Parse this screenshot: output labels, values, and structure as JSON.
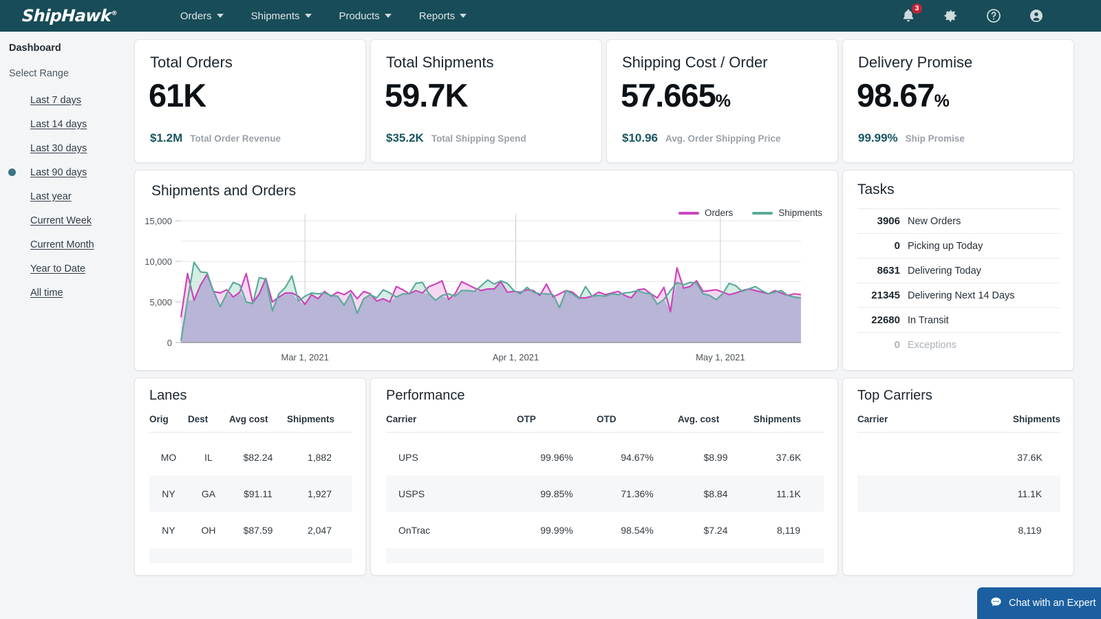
{
  "nav": {
    "logo": "ShipHawk",
    "logo_tm": "®",
    "items": [
      {
        "label": "Orders",
        "icon": "chevron-down-icon"
      },
      {
        "label": "Shipments",
        "icon": "chevron-down-icon"
      },
      {
        "label": "Products",
        "icon": "chevron-down-icon"
      },
      {
        "label": "Reports",
        "icon": "chevron-down-icon"
      }
    ],
    "notifications_badge": "3",
    "icons": [
      "bell-icon",
      "gear-icon",
      "help-icon",
      "account-icon"
    ],
    "background_color": "#174c58"
  },
  "sidebar": {
    "title": "Dashboard",
    "subtitle": "Select Range",
    "selected": "Last 90 days",
    "selected_color": "#3a7487",
    "items": [
      {
        "label": "Last 7 days",
        "selected": false
      },
      {
        "label": "Last 14 days",
        "selected": false
      },
      {
        "label": "Last 30 days",
        "selected": false
      },
      {
        "label": "Last 90 days",
        "selected": true
      },
      {
        "label": "Last year",
        "selected": false
      },
      {
        "label": "Current Week",
        "selected": false
      },
      {
        "label": "Current Month",
        "selected": false
      },
      {
        "label": "Year to Date",
        "selected": false
      },
      {
        "label": "All time",
        "selected": false
      }
    ]
  },
  "kpis": [
    {
      "title": "Total Orders",
      "value": "61K",
      "unit": "",
      "foot_value": "$1.2M",
      "foot_label": "Total Order Revenue"
    },
    {
      "title": "Total Shipments",
      "value": "59.7K",
      "unit": "",
      "foot_value": "$35.2K",
      "foot_label": "Total Shipping Spend"
    },
    {
      "title": "Shipping Cost / Order",
      "value": "57.665",
      "unit": "%",
      "foot_value": "$10.96",
      "foot_label": "Avg. Order Shipping Price"
    },
    {
      "title": "Delivery Promise",
      "value": "98.67",
      "unit": "%",
      "foot_value": "99.99%",
      "foot_label": "Ship Promise"
    }
  ],
  "chart_panel": {
    "title": "Shipments and Orders"
  },
  "chart_data": {
    "type": "area",
    "title": "Shipments and Orders",
    "xlabel": "",
    "ylabel": "",
    "ylim": [
      0,
      15000
    ],
    "yticks": [
      0,
      5000,
      10000,
      15000
    ],
    "ytick_labels": [
      "0",
      "5,000",
      "10,000",
      "15,000"
    ],
    "xtick_labels": [
      "Mar 1, 2021",
      "Apr 1, 2021",
      "May 1, 2021"
    ],
    "xtick_positions": [
      0.2,
      0.54,
      0.87
    ],
    "grid": true,
    "legend": "top-right",
    "colors": {
      "Orders": "#cc44bb",
      "Shipments": "#5aab9b",
      "orders_fill": "#f2c8ec",
      "shipments_fill": "#bfe3d8",
      "overlap_fill": "#b6b3d6"
    },
    "series": [
      {
        "name": "Orders",
        "color": "#cc44bb",
        "values": [
          3100,
          8500,
          5200,
          7100,
          8400,
          6300,
          6100,
          6500,
          5600,
          6200,
          8500,
          4900,
          6000,
          7900,
          5000,
          5600,
          6100,
          6100,
          5700,
          4700,
          5900,
          5400,
          6300,
          5700,
          6200,
          5900,
          6400,
          5400,
          6300,
          6000,
          5100,
          5400,
          5000,
          6900,
          6500,
          6000,
          6400,
          6100,
          6900,
          7200,
          7600,
          5300,
          6000,
          7500,
          7100,
          6700,
          6400,
          6600,
          6600,
          7500,
          6200,
          6300,
          6200,
          6500,
          6400,
          5800,
          7200,
          5600,
          6000,
          6400,
          6200,
          5500,
          5500,
          5700,
          6200,
          5900,
          6100,
          6300,
          5800,
          5500,
          6500,
          6600,
          6000,
          5500,
          6800,
          3800,
          9200,
          6700,
          6900,
          7600,
          6300,
          6400,
          6500,
          6200,
          5900,
          6100,
          6400,
          6600,
          6400,
          6200,
          6000,
          6400,
          6100,
          5800,
          6000,
          5900
        ]
      },
      {
        "name": "Shipments",
        "color": "#5aab9b",
        "values": [
          200,
          5200,
          9900,
          8700,
          8600,
          6300,
          4400,
          6000,
          7400,
          7100,
          5000,
          4800,
          8000,
          7800,
          3900,
          6000,
          6800,
          8200,
          5100,
          5700,
          6100,
          6000,
          6100,
          5800,
          5700,
          4600,
          6000,
          3600,
          5400,
          5900,
          5500,
          6500,
          6100,
          5600,
          6000,
          6000,
          7300,
          7400,
          6000,
          5200,
          5800,
          6000,
          5700,
          6400,
          6400,
          6300,
          7000,
          7700,
          7200,
          7600,
          7300,
          6400,
          6000,
          6800,
          6200,
          6000,
          6000,
          5900,
          4300,
          6400,
          6000,
          5400,
          6900,
          5700,
          5800,
          5700,
          6000,
          5900,
          6100,
          6200,
          6400,
          6100,
          6000,
          4700,
          5300,
          6400,
          7400,
          7100,
          7400,
          7300,
          6000,
          5800,
          5300,
          6000,
          7300,
          7000,
          6300,
          6600,
          6900,
          6400,
          6000,
          6200,
          6400,
          5800,
          5600,
          5500
        ]
      }
    ]
  },
  "tasks": {
    "title": "Tasks",
    "rows": [
      {
        "count": "3906",
        "label": "New Orders",
        "muted": false
      },
      {
        "count": "0",
        "label": "Picking up Today",
        "muted": false
      },
      {
        "count": "8631",
        "label": "Delivering Today",
        "muted": false
      },
      {
        "count": "21345",
        "label": "Delivering Next 14 Days",
        "muted": false
      },
      {
        "count": "22680",
        "label": "In Transit",
        "muted": false
      },
      {
        "count": "0",
        "label": "Exceptions",
        "muted": true
      }
    ]
  },
  "lanes": {
    "title": "Lanes",
    "columns": [
      "Orig",
      "Dest",
      "Avg cost",
      "Shipments"
    ],
    "rows": [
      [
        "MO",
        "IL",
        "$82.24",
        "1,882"
      ],
      [
        "NY",
        "GA",
        "$91.11",
        "1,927"
      ],
      [
        "NY",
        "OH",
        "$87.59",
        "2,047"
      ]
    ]
  },
  "performance": {
    "title": "Performance",
    "columns": [
      "Carrier",
      "OTP",
      "OTD",
      "Avg. cost",
      "Shipments"
    ],
    "rows": [
      [
        "UPS",
        "99.96%",
        "94.67%",
        "$8.99",
        "37.6K"
      ],
      [
        "USPS",
        "99.85%",
        "71.36%",
        "$8.84",
        "11.1K"
      ],
      [
        "OnTrac",
        "99.99%",
        "98.54%",
        "$7.24",
        "8,119"
      ]
    ]
  },
  "top_carriers": {
    "title": "Top Carriers",
    "columns": [
      "Carrier",
      "Shipments"
    ],
    "rows": [
      [
        "",
        "37.6K"
      ],
      [
        "",
        "11.1K"
      ],
      [
        "",
        "8,119"
      ]
    ]
  },
  "chat": {
    "label": "Chat with an Expert",
    "icon": "chat-bubble-icon",
    "color": "#1b5fa0"
  }
}
